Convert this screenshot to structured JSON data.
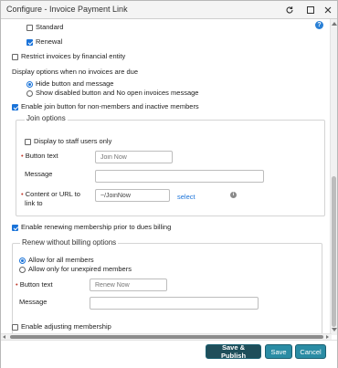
{
  "window": {
    "title": "Configure - Invoice Payment Link",
    "refresh_icon": "refresh-icon",
    "maximize_icon": "maximize-icon",
    "close_icon": "close-icon"
  },
  "help_icon": "help-icon",
  "options": {
    "standard": {
      "label": "Standard",
      "checked": false
    },
    "renewal": {
      "label": "Renewal",
      "checked": true
    },
    "restrict": {
      "label": "Restrict invoices by financial entity",
      "checked": false
    }
  },
  "display_options": {
    "heading": "Display options when no invoices are due",
    "hide": {
      "label": "Hide button and message",
      "selected": true
    },
    "show_disabled": {
      "label": "Show disabled button and No open invoices message",
      "selected": false
    }
  },
  "join": {
    "enable_label": "Enable join button for non-members and inactive members",
    "enabled": true,
    "fieldset_title": "Join options",
    "staff_only_label": "Display to staff users only",
    "staff_only": false,
    "button_text_label": "Button text",
    "button_text_placeholder": "Join Now",
    "message_label": "Message",
    "message_value": "",
    "content_label_line1": "Content or URL to",
    "content_label_line2": "link to",
    "content_value": "~/JoinNow",
    "select_link": "select",
    "info_icon": "info-icon"
  },
  "renew": {
    "enable_label": "Enable renewing membership prior to dues billing",
    "enabled": true,
    "fieldset_title": "Renew without billing options",
    "allow_all": {
      "label": "Allow for all members",
      "selected": true
    },
    "allow_unexpired": {
      "label": "Allow only for unexpired members",
      "selected": false
    },
    "button_text_label": "Button text",
    "button_text_placeholder": "Renew Now",
    "message_label": "Message",
    "message_value": ""
  },
  "adjust": {
    "label": "Enable adjusting membership",
    "enabled": false
  },
  "footer": {
    "save_publish": "Save & Publish",
    "save": "Save",
    "cancel": "Cancel"
  },
  "colors": {
    "primary_dark": "#1f4e5a",
    "primary_teal": "#2a8ca4",
    "accent_blue": "#1a73d9",
    "required_red": "#c0392b"
  }
}
